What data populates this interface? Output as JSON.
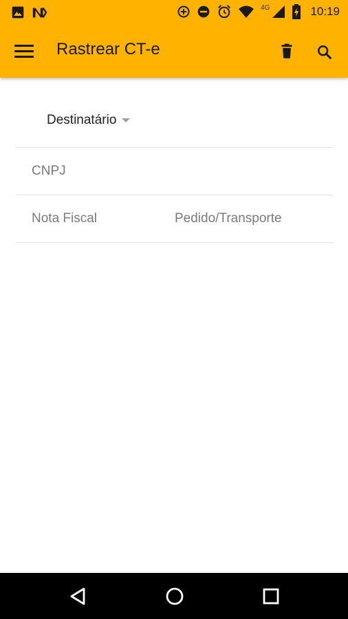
{
  "status_bar": {
    "network": "4G",
    "time": "10:19"
  },
  "toolbar": {
    "title": "Rastrear CT-e",
    "background": "#FFB300"
  },
  "form": {
    "recipient_type": "Destinatário",
    "cnpj_placeholder": "CNPJ",
    "nota_fiscal_placeholder": "Nota Fiscal",
    "pedido_placeholder": "Pedido/Transporte"
  },
  "icons": {
    "menu": "menu-icon",
    "delete": "trash-icon",
    "search": "search-icon",
    "back": "back-triangle-icon",
    "home": "home-circle-icon",
    "recents": "recents-square-icon"
  }
}
